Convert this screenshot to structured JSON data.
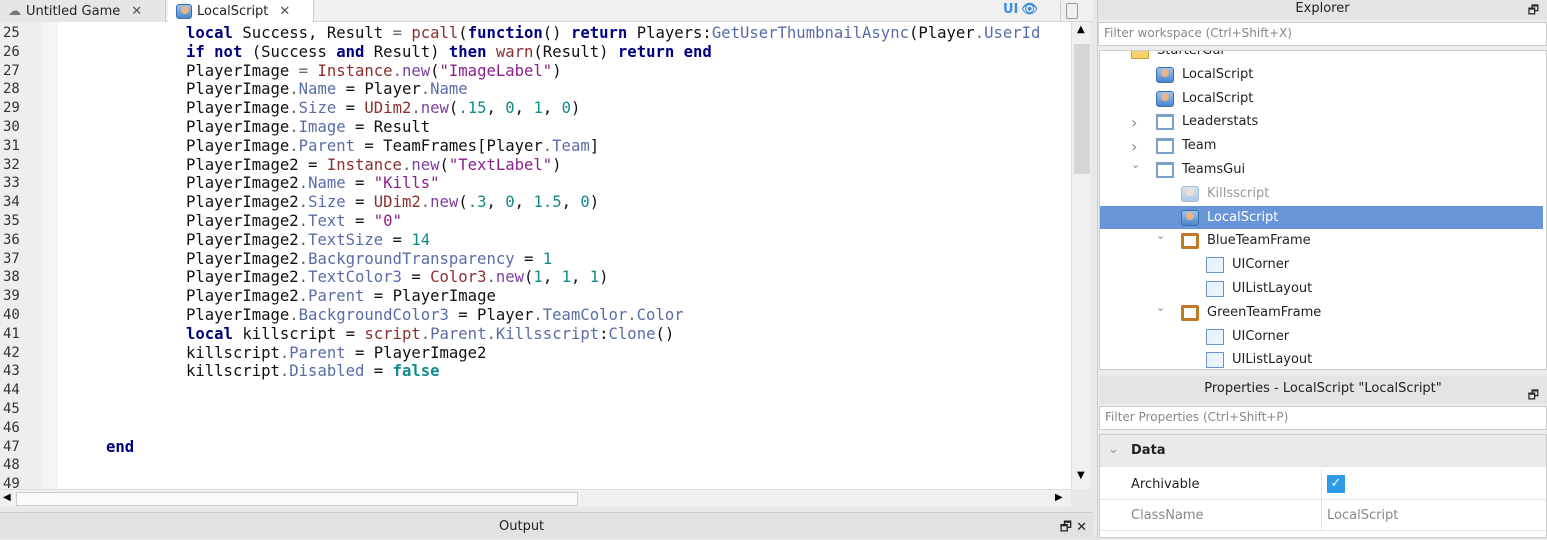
{
  "tabs": [
    {
      "label": "Untitled Game",
      "icon": "cloud-icon"
    },
    {
      "label": "LocalScript",
      "icon": "local-script-icon"
    }
  ],
  "toolbar": {
    "ui_label": "UI"
  },
  "code": {
    "lines": [
      {
        "n": "25",
        "indent": 12,
        "t": [
          [
            "local",
            "kw"
          ],
          [
            " Success, Result ",
            ""
          ],
          [
            "=",
            "op"
          ],
          [
            " ",
            ""
          ],
          [
            "pcall",
            "bi"
          ],
          [
            "(",
            ""
          ],
          [
            "function",
            "kw"
          ],
          [
            "() ",
            ""
          ],
          [
            "return",
            "kw"
          ],
          [
            " Players:",
            ""
          ],
          [
            "GetUserThumbnailAsync",
            "pr"
          ],
          [
            "(Player",
            ""
          ],
          [
            ".",
            "op"
          ],
          [
            "UserId",
            "pr"
          ]
        ]
      },
      {
        "n": "26",
        "indent": 12,
        "t": [
          [
            "if",
            "kw"
          ],
          [
            " ",
            ""
          ],
          [
            "not",
            "kw"
          ],
          [
            " (Success ",
            ""
          ],
          [
            "and",
            "kw"
          ],
          [
            " Result) ",
            ""
          ],
          [
            "then",
            "kw"
          ],
          [
            " ",
            ""
          ],
          [
            "warn",
            "bi"
          ],
          [
            "(Result) ",
            ""
          ],
          [
            "return",
            "kw"
          ],
          [
            " ",
            ""
          ],
          [
            "end",
            "kw"
          ]
        ]
      },
      {
        "n": "27",
        "indent": 12,
        "t": [
          [
            "PlayerImage ",
            ""
          ],
          [
            "=",
            "op"
          ],
          [
            " ",
            ""
          ],
          [
            "Instance",
            "bi"
          ],
          [
            ".",
            "op"
          ],
          [
            "new",
            "fn"
          ],
          [
            "(",
            ""
          ],
          [
            "\"ImageLabel\"",
            "st"
          ],
          [
            ")",
            ""
          ]
        ]
      },
      {
        "n": "28",
        "indent": 12,
        "t": [
          [
            "PlayerImage",
            ""
          ],
          [
            ".",
            "op"
          ],
          [
            "Name",
            "pr"
          ],
          [
            " = Player",
            ""
          ],
          [
            ".",
            "op"
          ],
          [
            "Name",
            "pr"
          ]
        ]
      },
      {
        "n": "29",
        "indent": 12,
        "t": [
          [
            "PlayerImage",
            ""
          ],
          [
            ".",
            "op"
          ],
          [
            "Size",
            "pr"
          ],
          [
            " = ",
            ""
          ],
          [
            "UDim2",
            "bi"
          ],
          [
            ".",
            "op"
          ],
          [
            "new",
            "fn"
          ],
          [
            "(",
            ""
          ],
          [
            ".15",
            "nu"
          ],
          [
            ", ",
            ""
          ],
          [
            "0",
            "nu"
          ],
          [
            ", ",
            ""
          ],
          [
            "1",
            "nu"
          ],
          [
            ", ",
            ""
          ],
          [
            "0",
            "nu"
          ],
          [
            ")",
            ""
          ]
        ]
      },
      {
        "n": "30",
        "indent": 12,
        "t": [
          [
            "PlayerImage",
            ""
          ],
          [
            ".",
            "op"
          ],
          [
            "Image",
            "pr"
          ],
          [
            " = Result",
            ""
          ]
        ]
      },
      {
        "n": "31",
        "indent": 12,
        "t": [
          [
            "PlayerImage",
            ""
          ],
          [
            ".",
            "op"
          ],
          [
            "Parent",
            "pr"
          ],
          [
            " = TeamFrames[Player",
            ""
          ],
          [
            ".",
            "op"
          ],
          [
            "Team",
            "pr"
          ],
          [
            "]",
            ""
          ]
        ]
      },
      {
        "n": "32",
        "indent": 12,
        "t": [
          [
            "PlayerImage2 = ",
            ""
          ],
          [
            "Instance",
            "bi"
          ],
          [
            ".",
            "op"
          ],
          [
            "new",
            "fn"
          ],
          [
            "(",
            ""
          ],
          [
            "\"TextLabel\"",
            "st"
          ],
          [
            ")",
            ""
          ]
        ]
      },
      {
        "n": "33",
        "indent": 12,
        "t": [
          [
            "PlayerImage2",
            ""
          ],
          [
            ".",
            "op"
          ],
          [
            "Name",
            "pr"
          ],
          [
            " = ",
            ""
          ],
          [
            "\"Kills\"",
            "st"
          ]
        ]
      },
      {
        "n": "34",
        "indent": 12,
        "t": [
          [
            "PlayerImage2",
            ""
          ],
          [
            ".",
            "op"
          ],
          [
            "Size",
            "pr"
          ],
          [
            " = ",
            ""
          ],
          [
            "UDim2",
            "bi"
          ],
          [
            ".",
            "op"
          ],
          [
            "new",
            "fn"
          ],
          [
            "(",
            ""
          ],
          [
            ".3",
            "nu"
          ],
          [
            ", ",
            ""
          ],
          [
            "0",
            "nu"
          ],
          [
            ", ",
            ""
          ],
          [
            "1.5",
            "nu"
          ],
          [
            ", ",
            ""
          ],
          [
            "0",
            "nu"
          ],
          [
            ")",
            ""
          ]
        ]
      },
      {
        "n": "35",
        "indent": 12,
        "t": [
          [
            "PlayerImage2",
            ""
          ],
          [
            ".",
            "op"
          ],
          [
            "Text",
            "pr"
          ],
          [
            " = ",
            ""
          ],
          [
            "\"0\"",
            "st"
          ]
        ]
      },
      {
        "n": "36",
        "indent": 12,
        "t": [
          [
            "PlayerImage2",
            ""
          ],
          [
            ".",
            "op"
          ],
          [
            "TextSize",
            "pr"
          ],
          [
            " = ",
            ""
          ],
          [
            "14",
            "nu"
          ]
        ]
      },
      {
        "n": "37",
        "indent": 12,
        "t": [
          [
            "PlayerImage2",
            ""
          ],
          [
            ".",
            "op"
          ],
          [
            "BackgroundTransparency",
            "pr"
          ],
          [
            " = ",
            ""
          ],
          [
            "1",
            "nu"
          ]
        ]
      },
      {
        "n": "38",
        "indent": 12,
        "t": [
          [
            "PlayerImage2",
            ""
          ],
          [
            ".",
            "op"
          ],
          [
            "TextColor3",
            "pr"
          ],
          [
            " = ",
            ""
          ],
          [
            "Color3",
            "bi"
          ],
          [
            ".",
            "op"
          ],
          [
            "new",
            "fn"
          ],
          [
            "(",
            ""
          ],
          [
            "1",
            "nu"
          ],
          [
            ", ",
            ""
          ],
          [
            "1",
            "nu"
          ],
          [
            ", ",
            ""
          ],
          [
            "1",
            "nu"
          ],
          [
            ")",
            ""
          ]
        ]
      },
      {
        "n": "39",
        "indent": 12,
        "t": [
          [
            "PlayerImage2",
            ""
          ],
          [
            ".",
            "op"
          ],
          [
            "Parent",
            "pr"
          ],
          [
            " = PlayerImage",
            ""
          ]
        ]
      },
      {
        "n": "40",
        "indent": 12,
        "t": [
          [
            "PlayerImage",
            ""
          ],
          [
            ".",
            "op"
          ],
          [
            "BackgroundColor3",
            "pr"
          ],
          [
            " = Player",
            ""
          ],
          [
            ".",
            "op"
          ],
          [
            "TeamColor",
            "pr"
          ],
          [
            ".",
            "op"
          ],
          [
            "Color",
            "pr"
          ]
        ]
      },
      {
        "n": "41",
        "indent": 12,
        "t": [
          [
            "local",
            "kw"
          ],
          [
            " killscript = ",
            ""
          ],
          [
            "script",
            "bi"
          ],
          [
            ".",
            "op"
          ],
          [
            "Parent",
            "pr"
          ],
          [
            ".",
            "op"
          ],
          [
            "Killsscript",
            "pr"
          ],
          [
            ":",
            ""
          ],
          [
            "Clone",
            "pr"
          ],
          [
            "()",
            ""
          ]
        ]
      },
      {
        "n": "42",
        "indent": 12,
        "t": [
          [
            "killscript",
            ""
          ],
          [
            ".",
            "op"
          ],
          [
            "Parent",
            "pr"
          ],
          [
            " = PlayerImage2",
            ""
          ]
        ]
      },
      {
        "n": "43",
        "indent": 12,
        "t": [
          [
            "killscript",
            ""
          ],
          [
            ".",
            "op"
          ],
          [
            "Disabled",
            "pr"
          ],
          [
            " = ",
            ""
          ],
          [
            "false",
            "bo"
          ]
        ]
      },
      {
        "n": "44",
        "indent": 0,
        "t": []
      },
      {
        "n": "45",
        "indent": 0,
        "t": []
      },
      {
        "n": "46",
        "indent": 0,
        "t": []
      },
      {
        "n": "47",
        "indent": 4,
        "t": [
          [
            "end",
            "kw"
          ]
        ]
      },
      {
        "n": "48",
        "indent": 0,
        "t": []
      },
      {
        "n": "49",
        "indent": 0,
        "t": []
      }
    ]
  },
  "output": {
    "title": "Output"
  },
  "explorer": {
    "title": "Explorer",
    "filter_placeholder": "Filter workspace (Ctrl+Shift+X)",
    "items": [
      {
        "label": "StarterGui",
        "icon": "folder",
        "depth": 0,
        "chev": "down"
      },
      {
        "label": "LocalScript",
        "icon": "script",
        "depth": 1,
        "chev": ""
      },
      {
        "label": "LocalScript",
        "icon": "script",
        "depth": 1,
        "chev": ""
      },
      {
        "label": "Leaderstats",
        "icon": "frame",
        "depth": 1,
        "chev": "right"
      },
      {
        "label": "Team",
        "icon": "frame",
        "depth": 1,
        "chev": "right"
      },
      {
        "label": "TeamsGui",
        "icon": "frame",
        "depth": 1,
        "chev": "down"
      },
      {
        "label": "Killsscript",
        "icon": "script",
        "depth": 2,
        "chev": "",
        "disabled": true
      },
      {
        "label": "LocalScript",
        "icon": "script",
        "depth": 2,
        "chev": "",
        "selected": true
      },
      {
        "label": "BlueTeamFrame",
        "icon": "gframe",
        "depth": 2,
        "chev": "down"
      },
      {
        "label": "UICorner",
        "icon": "layout",
        "depth": 3,
        "chev": ""
      },
      {
        "label": "UIListLayout",
        "icon": "layout",
        "depth": 3,
        "chev": ""
      },
      {
        "label": "GreenTeamFrame",
        "icon": "gframe",
        "depth": 2,
        "chev": "down"
      },
      {
        "label": "UICorner",
        "icon": "layout",
        "depth": 3,
        "chev": ""
      },
      {
        "label": "UIListLayout",
        "icon": "layout",
        "depth": 3,
        "chev": ""
      }
    ]
  },
  "properties": {
    "title": "Properties - LocalScript \"LocalScript\"",
    "filter_placeholder": "Filter Properties (Ctrl+Shift+P)",
    "section": "Data",
    "rows": [
      {
        "name": "Archivable",
        "value": "",
        "checked": true
      },
      {
        "name": "ClassName",
        "value": "LocalScript"
      }
    ]
  },
  "colors": {
    "selection": "#6895d8",
    "keyword": "#00007f",
    "string": "#8b1f8b",
    "number": "#118a8a",
    "property": "#5a6ca8"
  }
}
